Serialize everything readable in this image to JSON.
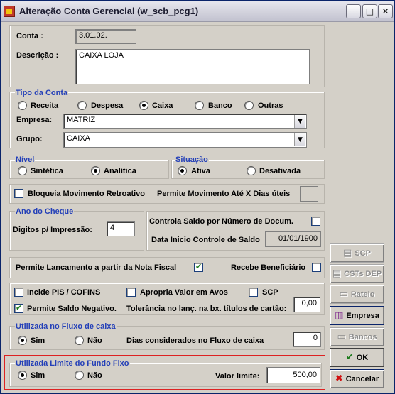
{
  "window": {
    "title": "Alteração Conta Gerencial (w_scb_pcg1)",
    "controls": {
      "minimize": "_",
      "maximize": "□",
      "close": "✕"
    }
  },
  "conta": {
    "label": "Conta :",
    "value": "3.01.02."
  },
  "descricao": {
    "label": "Descrição :",
    "value": "CAIXA LOJA"
  },
  "tipo_conta": {
    "title": "Tipo da Conta",
    "options": [
      "Receita",
      "Despesa",
      "Caixa",
      "Banco",
      "Outras"
    ],
    "selected": "Caixa"
  },
  "empresa": {
    "label": "Empresa:",
    "value": "MATRIZ"
  },
  "grupo": {
    "label": "Grupo:",
    "value": "CAIXA"
  },
  "nivel": {
    "title": "Nível",
    "options": [
      "Sintética",
      "Analítica"
    ],
    "selected": "Analítica"
  },
  "situacao": {
    "title": "Situação",
    "options": [
      "Ativa",
      "Desativada"
    ],
    "selected": "Ativa"
  },
  "bloqueia": {
    "label": "Bloqueia Movimento Retroativo",
    "checked": false,
    "dias_label": "Permite Movimento Até X Dias úteis",
    "dias_value": ""
  },
  "ano_cheque": {
    "title": "Ano do Cheque",
    "digitos_label": "Digitos p/ Impressão:",
    "digitos_value": "4"
  },
  "controla_saldo": {
    "label": "Controla  Saldo por Número de Docum.",
    "checked": false,
    "data_label": "Data Inicio Controle de Saldo",
    "data_value": "01/01/1900"
  },
  "lancamento": {
    "permite_label": "Permite Lancamento a partir da Nota Fiscal",
    "permite_checked": true,
    "recebe_label": "Recebe Beneficiário",
    "recebe_checked": false
  },
  "opcoes": {
    "incide_label": "Incide PIS / COFINS",
    "incide_checked": false,
    "apropria_label": "Apropria Valor em Avos",
    "apropria_checked": false,
    "scp_label": "SCP",
    "scp_checked": false,
    "saldo_neg_label": "Permite Saldo Negativo.",
    "saldo_neg_checked": true,
    "tolerancia_label": "Tolerância no lanç. na bx. títulos de cartão:",
    "tolerancia_value": "0,00"
  },
  "fluxo_caixa": {
    "title": "Utilizada no Fluxo de caixa",
    "options": [
      "Sim",
      "Não"
    ],
    "selected": "Sim",
    "dias_label": "Dias considerados no Fluxo de caixa",
    "dias_value": "0"
  },
  "fundo_fixo": {
    "title": "Utilizada Limite do Fundo Fixo",
    "options": [
      "Sim",
      "Não"
    ],
    "selected": "Sim",
    "valor_label": "Valor limite:",
    "valor_value": "500,00"
  },
  "actions": {
    "scp": "SCP",
    "csts_dep": "CSTs DEP",
    "rateio": "Rateio",
    "empresa": "Empresa",
    "bancos": "Bancos",
    "ok": "OK",
    "cancelar": "Cancelar"
  },
  "colors": {
    "group_title": "#2440b8",
    "highlight_frame": "#dd2222",
    "window_bg": "#d4d0c8"
  }
}
